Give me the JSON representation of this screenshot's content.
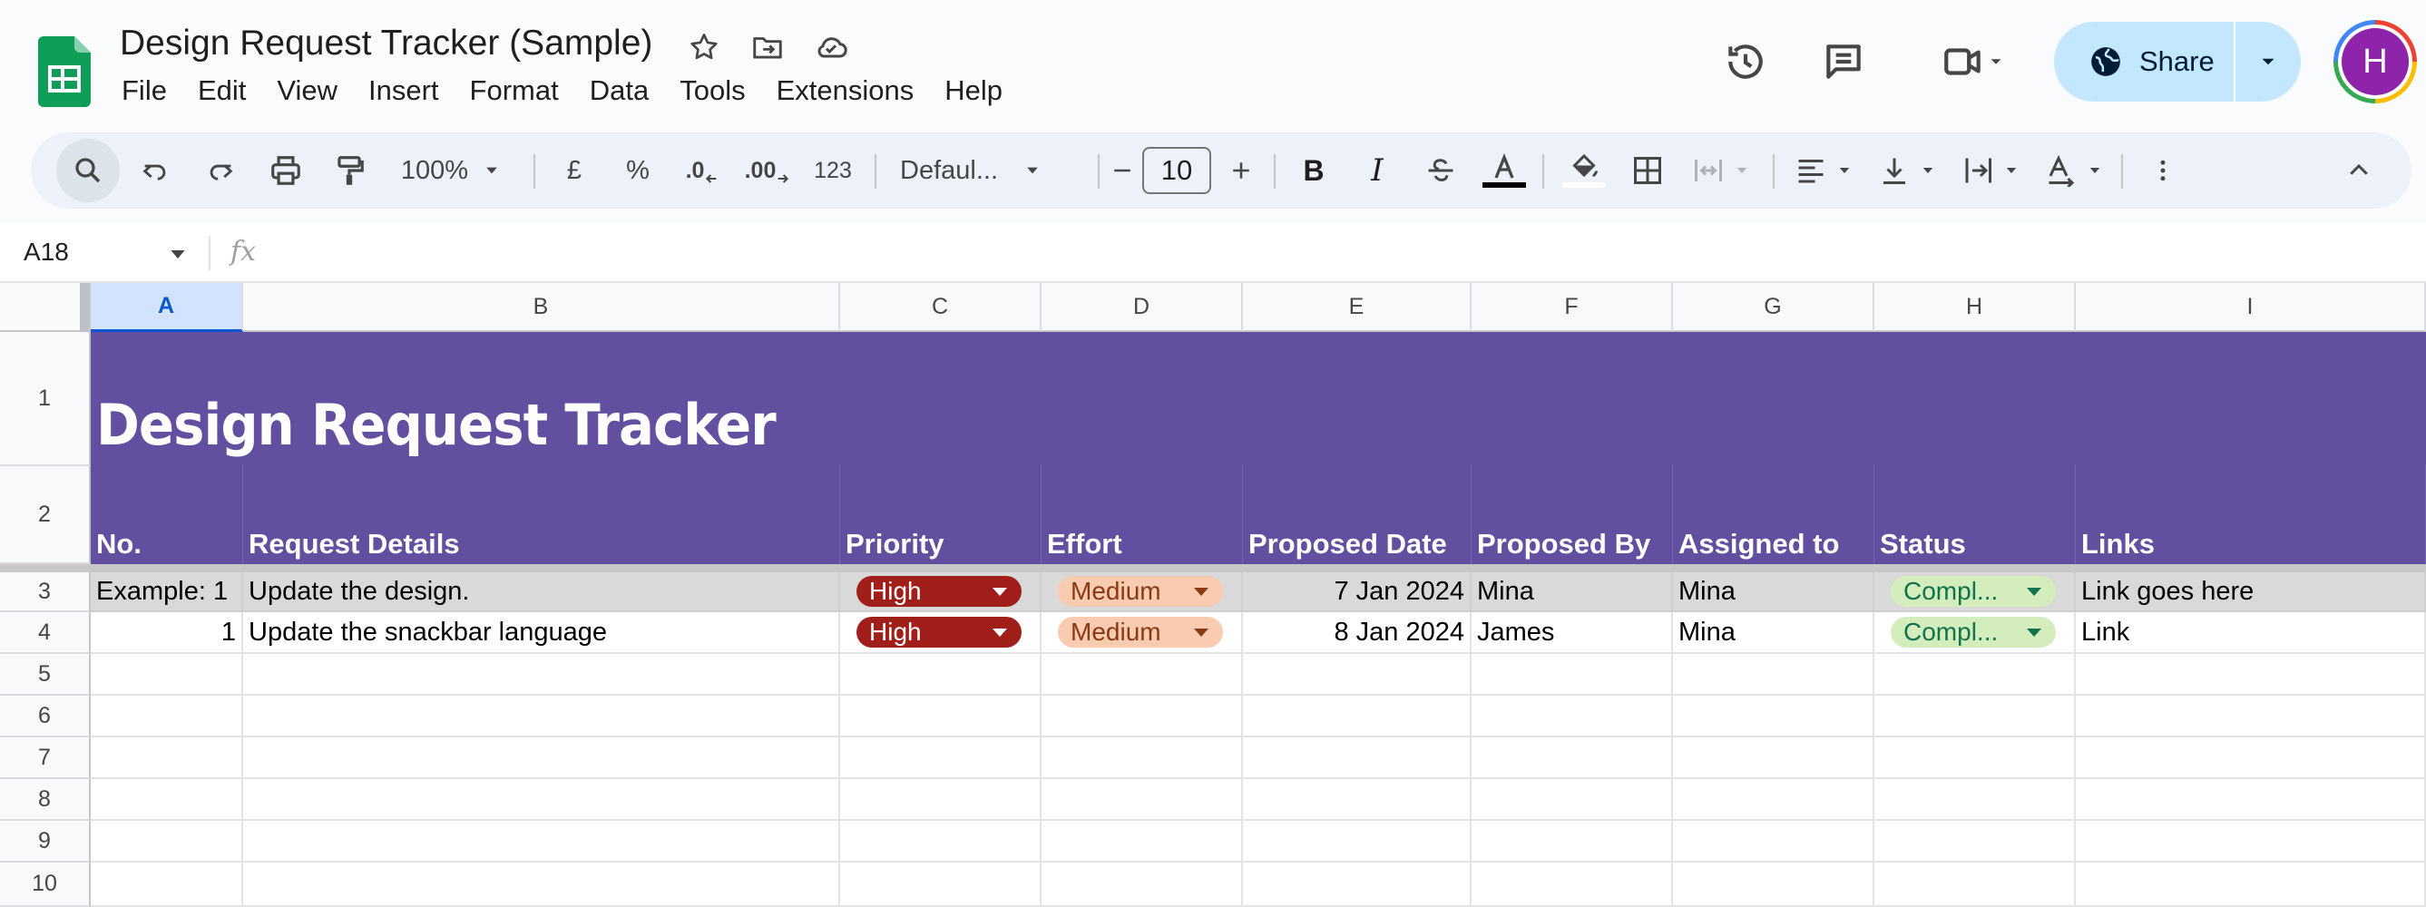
{
  "doc": {
    "title": "Design Request Tracker (Sample)",
    "menu": [
      "File",
      "Edit",
      "View",
      "Insert",
      "Format",
      "Data",
      "Tools",
      "Extensions",
      "Help"
    ],
    "share_label": "Share",
    "avatar_initial": "H"
  },
  "toolbar": {
    "zoom": "100%",
    "currency": "£",
    "percent": "%",
    "decrease_decimal": ".0",
    "increase_decimal": ".00",
    "more_formats": "123",
    "font": "Defaul...",
    "font_size": "10"
  },
  "formula_bar": {
    "cell_ref": "A18",
    "fx": "fx",
    "value": ""
  },
  "grid": {
    "columns": [
      "A",
      "B",
      "C",
      "D",
      "E",
      "F",
      "G",
      "H",
      "I"
    ],
    "selected_column": "A",
    "rows": [
      "1",
      "2",
      "3",
      "4",
      "5",
      "6",
      "7",
      "8",
      "9",
      "10"
    ]
  },
  "sheet": {
    "title": "Design Request Tracker",
    "headers": [
      "No.",
      "Request Details",
      "Priority",
      "Effort",
      "Proposed Date",
      "Proposed By",
      "Assigned to",
      "Status",
      "Links"
    ],
    "data_rows": [
      {
        "no": "Example: 1",
        "details": "Update the design.",
        "priority": "High",
        "effort": "Medium",
        "date": "7 Jan 2024",
        "proposed_by": "Mina",
        "assigned_to": "Mina",
        "status": "Compl...",
        "link": "Link goes here"
      },
      {
        "no": "1",
        "details": "Update the snackbar language",
        "priority": "High",
        "effort": "Medium",
        "date": "8 Jan 2024",
        "proposed_by": "James",
        "assigned_to": "Mina",
        "status": "Compl...",
        "link": "Link"
      }
    ]
  },
  "colors": {
    "banner": "#624fa0",
    "priority_high": "#a11f1b",
    "effort_medium": "#f9cbb0",
    "status_complete": "#d4edbc",
    "share": "#c2e7ff"
  }
}
